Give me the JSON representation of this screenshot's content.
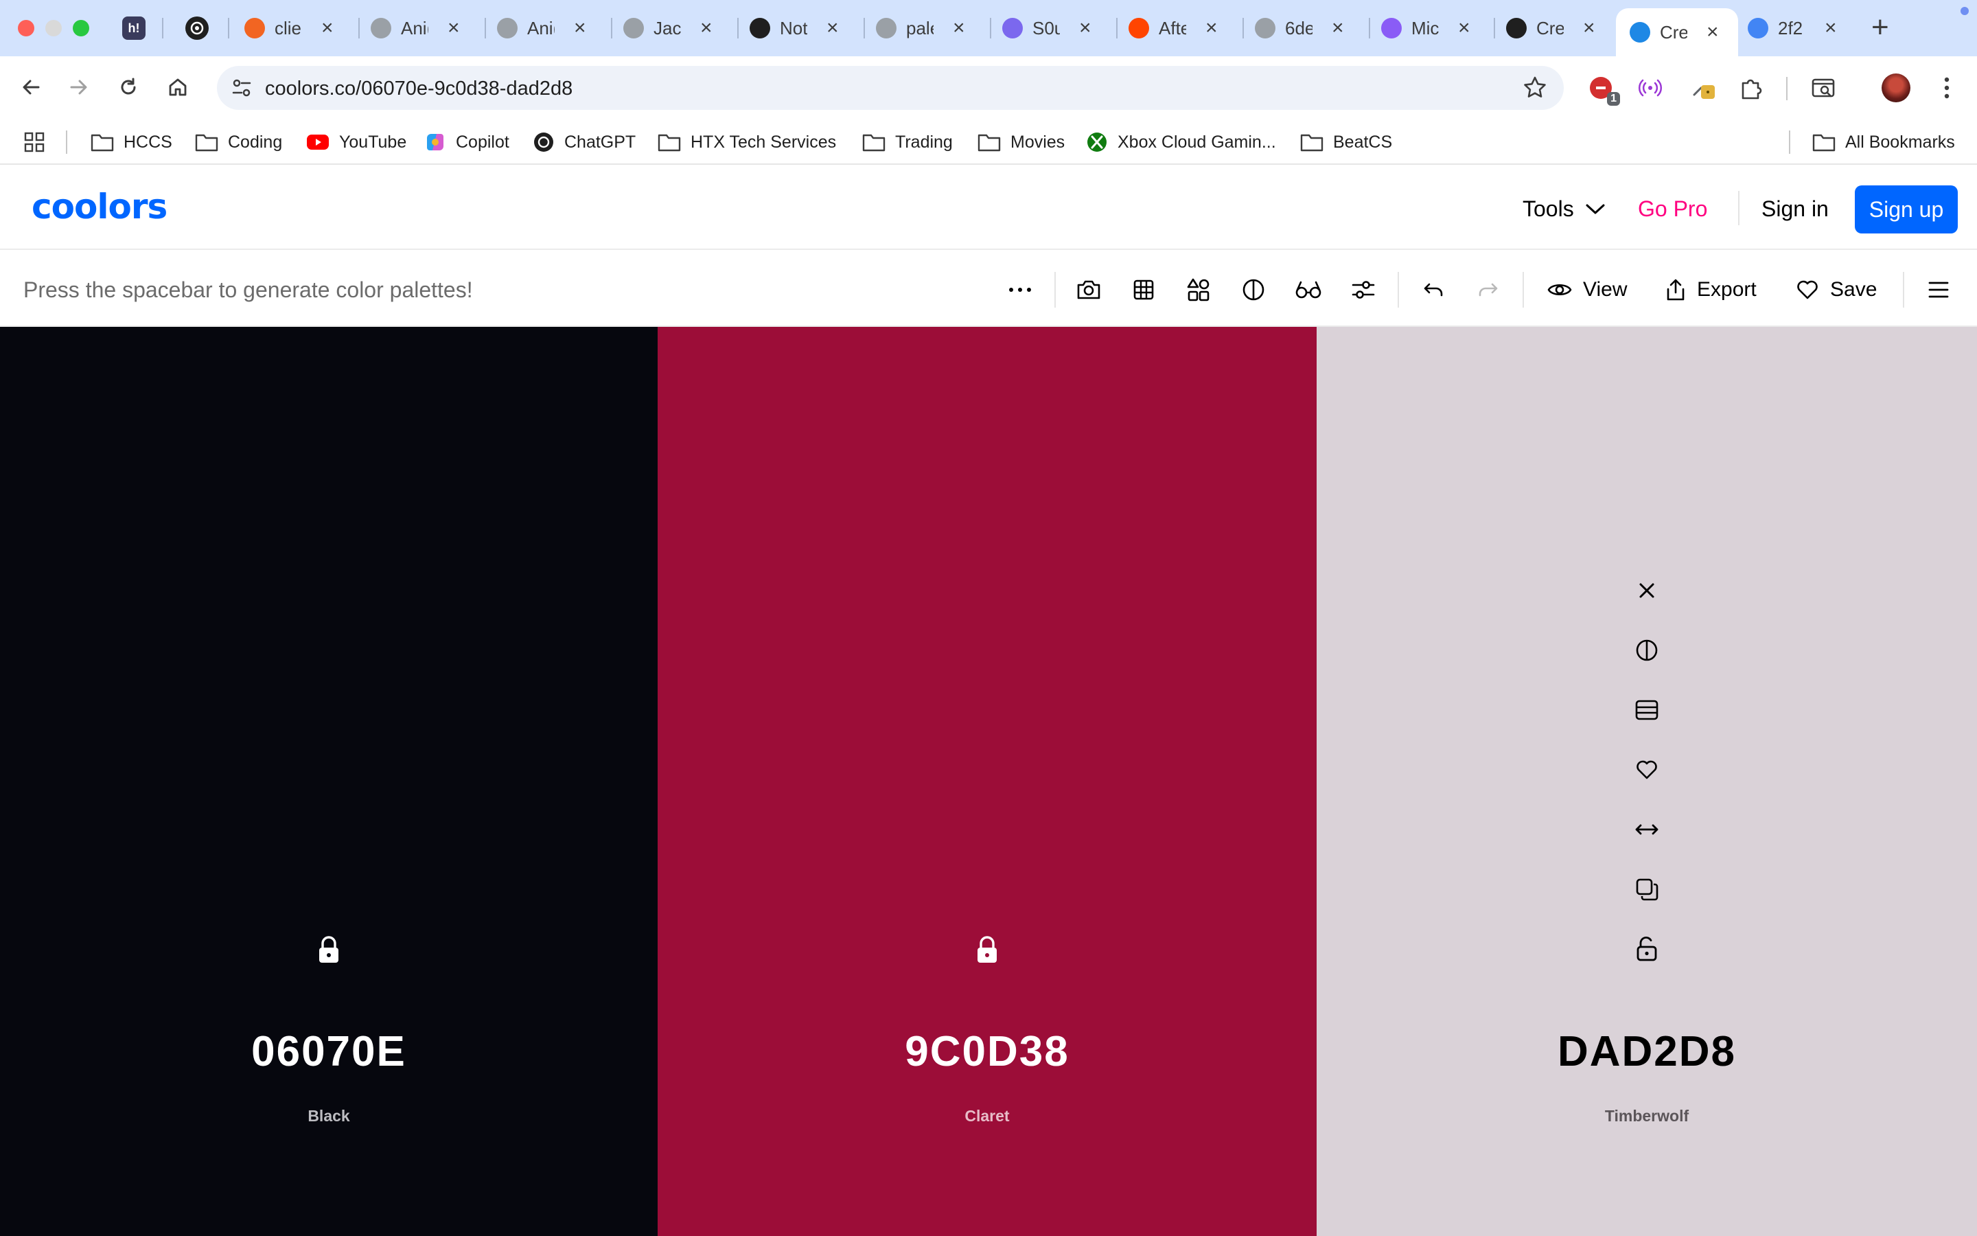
{
  "browser": {
    "tabs": [
      {
        "title": "clie",
        "favicon_color": "#f26522"
      },
      {
        "title": "Ani(",
        "favicon_color": "#9aa0a6"
      },
      {
        "title": "Ani(",
        "favicon_color": "#9aa0a6"
      },
      {
        "title": "Jaci",
        "favicon_color": "#9aa0a6"
      },
      {
        "title": "Not",
        "favicon_color": "#1f1f1f"
      },
      {
        "title": "pale",
        "favicon_color": "#9aa0a6"
      },
      {
        "title": "S0u",
        "favicon_color": "#7b68ee"
      },
      {
        "title": "Afte",
        "favicon_color": "#ff4500"
      },
      {
        "title": "6de",
        "favicon_color": "#9aa0a6"
      },
      {
        "title": "Mic",
        "favicon_color": "#8a5cf6"
      },
      {
        "title": "Cre",
        "favicon_color": "#1f1f1f"
      },
      {
        "title": "Cre",
        "favicon_color": "#1e88e5"
      },
      {
        "title": "2f2",
        "favicon_color": "#4285f4"
      }
    ],
    "pinned_1": "h!",
    "new_tab": "+",
    "url": "coolors.co/06070e-9c0d38-dad2d8",
    "extension_badge": "1"
  },
  "bookmarks": {
    "items": [
      {
        "label": "HCCS",
        "icon": "folder-icon"
      },
      {
        "label": "Coding",
        "icon": "folder-icon"
      },
      {
        "label": "YouTube",
        "icon": "youtube-icon"
      },
      {
        "label": "Copilot",
        "icon": "copilot-icon"
      },
      {
        "label": "ChatGPT",
        "icon": "chatgpt-icon"
      },
      {
        "label": "HTX Tech Services",
        "icon": "folder-icon"
      },
      {
        "label": "Trading",
        "icon": "folder-icon"
      },
      {
        "label": "Movies",
        "icon": "folder-icon"
      },
      {
        "label": "Xbox Cloud Gamin...",
        "icon": "xbox-icon"
      },
      {
        "label": "BeatCS",
        "icon": "folder-icon"
      }
    ],
    "all_bookmarks": "All Bookmarks"
  },
  "site": {
    "logo": "coolors",
    "nav": {
      "tools": "Tools",
      "go_pro": "Go Pro",
      "sign_in": "Sign in",
      "sign_up": "Sign up"
    },
    "accent_color": "#0066ff",
    "pro_color": "#ff0080"
  },
  "generator": {
    "hint": "Press the spacebar to generate color palettes!",
    "view_label": "View",
    "export_label": "Export",
    "save_label": "Save"
  },
  "palette": [
    {
      "hex": "06070E",
      "name": "Black",
      "color": "#06070e",
      "text_color": "#ffffff",
      "name_color": "#bdbdc2",
      "locked": true
    },
    {
      "hex": "9C0D38",
      "name": "Claret",
      "color": "#9c0d38",
      "text_color": "#ffffff",
      "name_color": "#e7bcc8",
      "locked": true
    },
    {
      "hex": "DAD2D8",
      "name": "Timberwolf",
      "color": "#dad2d8",
      "text_color": "#000000",
      "name_color": "#5b5559",
      "locked": false
    }
  ]
}
